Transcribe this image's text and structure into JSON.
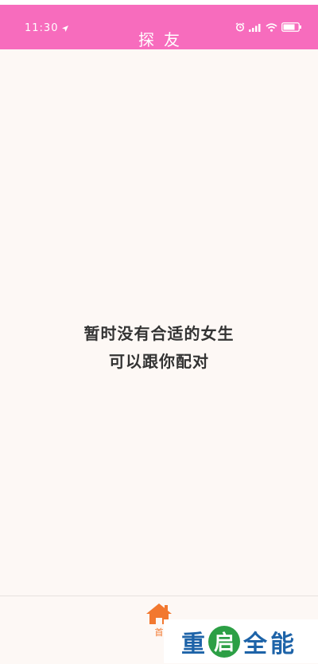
{
  "status_bar": {
    "time": "11:30",
    "icons": [
      "location-arrow-icon",
      "alarm-icon",
      "signal-icon",
      "wifi-icon",
      "battery-icon"
    ]
  },
  "header": {
    "title": "探友",
    "background": "#f76cbd"
  },
  "main": {
    "empty_line1": "暂时没有合适的女生",
    "empty_line2": "可以跟你配对"
  },
  "tabbar": {
    "home_label": "首",
    "home_icon": "home-icon",
    "accent": "#f2782f"
  },
  "watermark": {
    "char1": "重",
    "char2": "启",
    "char3": "全",
    "char4": "能"
  }
}
